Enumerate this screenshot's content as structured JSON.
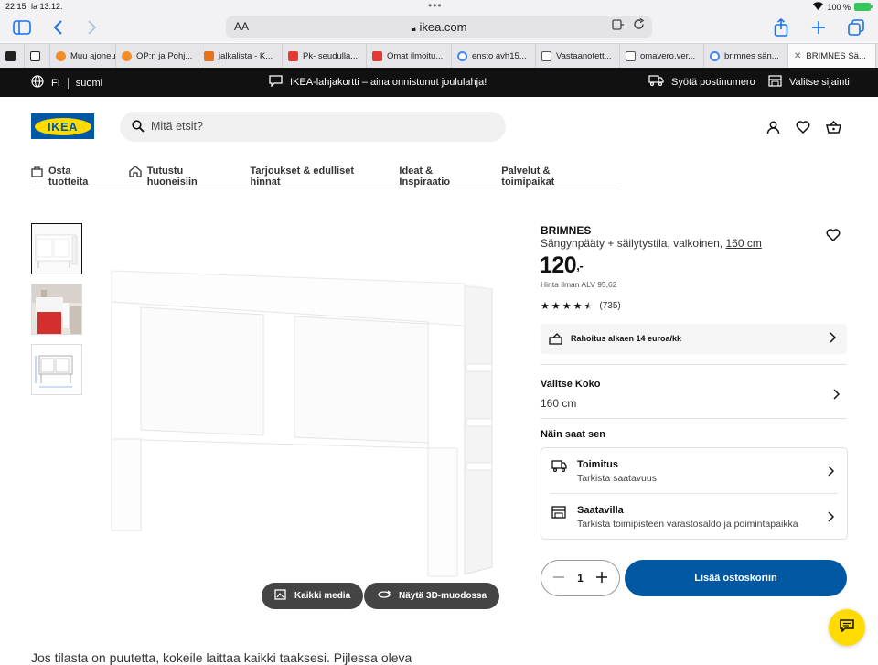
{
  "status": {
    "time": "22.15",
    "date": "la 13.12.",
    "battery": "100 %"
  },
  "browser": {
    "url": "ikea.com",
    "aa": "AA",
    "tabs": [
      {
        "label": "",
        "color": "#222"
      },
      {
        "label": "Muu ajoneu",
        "color": "#f28c28"
      },
      {
        "label": "OP:n ja Pohj...",
        "color": "#f28c28"
      },
      {
        "label": "jalkalista - K...",
        "color": "#e8711b"
      },
      {
        "label": "Pk- seudulla...",
        "color": "#e53935"
      },
      {
        "label": "Omat ilmoitu...",
        "color": "#e53935"
      },
      {
        "label": "ensto avh15...",
        "color": "#4285f4"
      },
      {
        "label": "Vastaanotett...",
        "color": "#666"
      },
      {
        "label": "omavero.ver...",
        "color": "#666"
      },
      {
        "label": "brimnes sän...",
        "color": "#4285f4"
      },
      {
        "label": "BRIMNES Sä...",
        "color": "#888"
      }
    ]
  },
  "topbar": {
    "country": "FI",
    "language": "suomi",
    "promo": "IKEA-lahjakortti – aina onnistunut joululahja!",
    "postcode": "Syötä postinumero",
    "location": "Valitse sijainti"
  },
  "header": {
    "logo": "IKEA",
    "search_placeholder": "Mitä etsit?"
  },
  "nav": {
    "shop": "Osta tuotteita",
    "rooms": "Tutustu huoneisiin",
    "offers": "Tarjoukset & edulliset hinnat",
    "ideas": "Ideat & Inspiraatio",
    "services": "Palvelut & toimipaikat"
  },
  "media": {
    "all_media": "Kaikki media",
    "view_3d": "Näytä 3D-muodossa"
  },
  "product": {
    "name": "BRIMNES",
    "description": "Sängynpääty + säilytystila, valkoinen,",
    "size_link": "160 cm",
    "price": "120",
    "price_suffix": ",-",
    "price_vat": "Hinta ilman ALV 95,62",
    "rating": 4.5,
    "reviews": "(735)",
    "financing": "Rahoitus alkaen 14 euroa/kk",
    "choose_size_label": "Valitse Koko",
    "choose_size_value": "160 cm",
    "how_to_get": "Näin saat sen",
    "delivery_title": "Toimitus",
    "delivery_sub": "Tarkista saatavuus",
    "availability_title": "Saatavilla",
    "availability_sub": "Tarkista toimipisteen varastosaldo ja poimintapaikka",
    "quantity": "1",
    "add_to_cart": "Lisää ostoskoriin"
  },
  "body_text": "Jos tilasta on puutetta, kokeile laittaa kaikki taaksesi. Pijlessa oleva"
}
